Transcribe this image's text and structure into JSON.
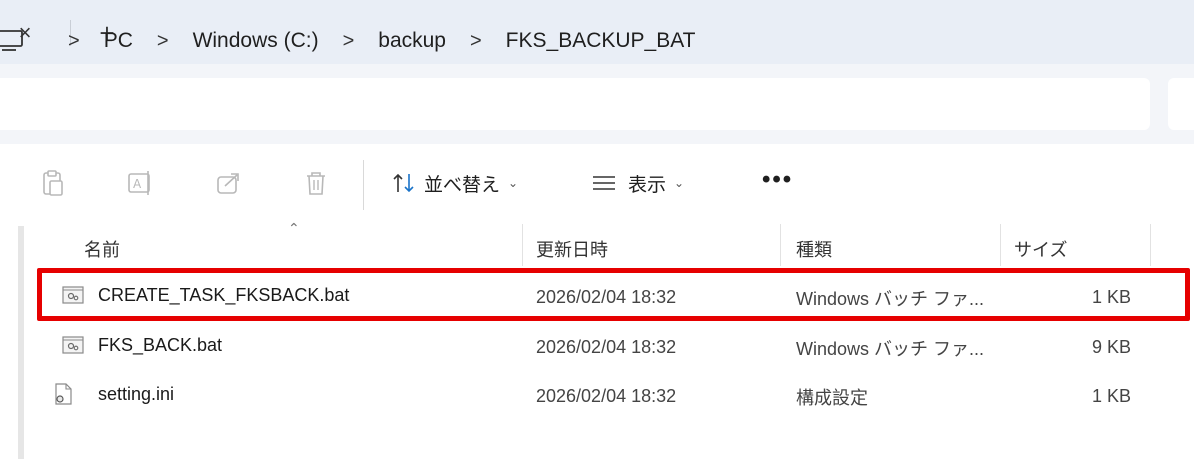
{
  "tabbar": {
    "close_icon": "close-icon",
    "new_tab_icon": "plus-icon"
  },
  "address": {
    "root_icon": "pc-icon",
    "separator": ">",
    "crumbs": [
      "PC",
      "Windows (C:)",
      "backup",
      "FKS_BACKUP_BAT"
    ]
  },
  "commands": {
    "icons": [
      "paste-icon",
      "rename-icon",
      "share-icon",
      "delete-icon"
    ],
    "sort_label": "並べ替え",
    "view_label": "表示",
    "more_label": "•••"
  },
  "columns": {
    "name": "名前",
    "modified": "更新日時",
    "type": "種類",
    "size": "サイズ"
  },
  "files": [
    {
      "name": "CREATE_TASK_FKSBACK.bat",
      "modified": "2026/02/04 18:32",
      "type": "Windows バッチ ファ...",
      "size": "1 KB",
      "icon": "batch-file-icon"
    },
    {
      "name": "FKS_BACK.bat",
      "modified": "2026/02/04 18:32",
      "type": "Windows バッチ ファ...",
      "size": "9 KB",
      "icon": "batch-file-icon"
    },
    {
      "name": "setting.ini",
      "modified": "2026/02/04 18:32",
      "type": "構成設定",
      "size": "1 KB",
      "icon": "config-file-icon"
    }
  ],
  "colors": {
    "highlight": "#e60000",
    "tabbar_bg": "#e9eef6",
    "addrbar_bg": "#f3f5f9"
  }
}
